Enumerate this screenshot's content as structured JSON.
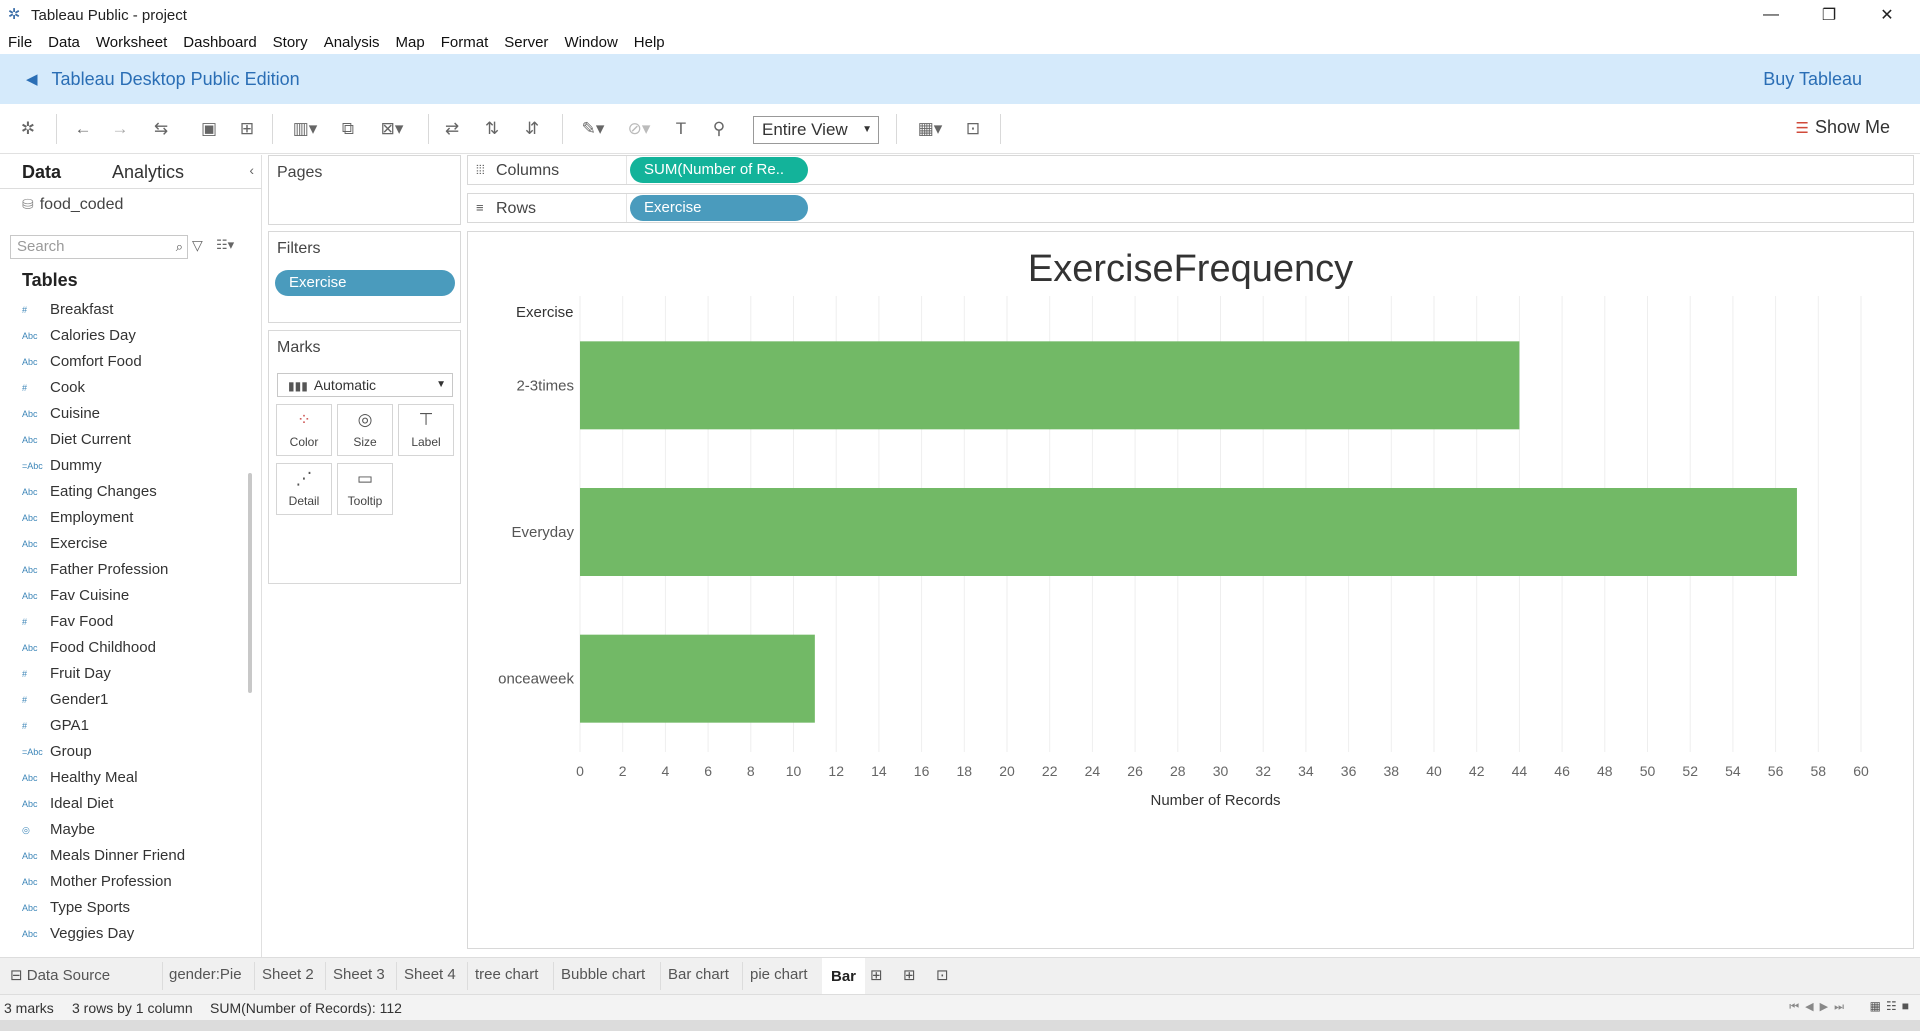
{
  "window": {
    "title": "Tableau Public - project",
    "minimize": "—",
    "restore": "❐",
    "close": "✕"
  },
  "menu": [
    "File",
    "Data",
    "Worksheet",
    "Dashboard",
    "Story",
    "Analysis",
    "Map",
    "Format",
    "Server",
    "Window",
    "Help"
  ],
  "promo": {
    "edition": "Tableau Desktop Public Edition",
    "buy": "Buy Tableau"
  },
  "toolbar": {
    "fit": "Entire View",
    "show_me": "Show Me"
  },
  "left_panel": {
    "tabs": [
      "Data",
      "Analytics"
    ],
    "datasource": "food_coded",
    "search_placeholder": "Search",
    "tables_heading": "Tables",
    "fields": [
      {
        "type": "#",
        "name": "Breakfast"
      },
      {
        "type": "Abc",
        "name": "Calories Day"
      },
      {
        "type": "Abc",
        "name": "Comfort Food"
      },
      {
        "type": "#",
        "name": "Cook"
      },
      {
        "type": "Abc",
        "name": "Cuisine"
      },
      {
        "type": "Abc",
        "name": "Diet Current"
      },
      {
        "type": "=Abc",
        "name": "Dummy"
      },
      {
        "type": "Abc",
        "name": "Eating Changes"
      },
      {
        "type": "Abc",
        "name": "Employment"
      },
      {
        "type": "Abc",
        "name": "Exercise"
      },
      {
        "type": "Abc",
        "name": "Father Profession"
      },
      {
        "type": "Abc",
        "name": "Fav Cuisine"
      },
      {
        "type": "#",
        "name": "Fav Food"
      },
      {
        "type": "Abc",
        "name": "Food Childhood"
      },
      {
        "type": "#",
        "name": "Fruit Day"
      },
      {
        "type": "#",
        "name": "Gender1"
      },
      {
        "type": "#",
        "name": "GPA1"
      },
      {
        "type": "=Abc",
        "name": "Group"
      },
      {
        "type": "Abc",
        "name": "Healthy Meal"
      },
      {
        "type": "Abc",
        "name": "Ideal Diet"
      },
      {
        "type": "◎",
        "name": "Maybe"
      },
      {
        "type": "Abc",
        "name": "Meals Dinner Friend"
      },
      {
        "type": "Abc",
        "name": "Mother Profession"
      },
      {
        "type": "Abc",
        "name": "Type Sports"
      },
      {
        "type": "Abc",
        "name": "Veggies Day"
      }
    ]
  },
  "pages": {
    "title": "Pages"
  },
  "filters": {
    "title": "Filters",
    "pill": "Exercise"
  },
  "marks": {
    "title": "Marks",
    "type": "Automatic",
    "buttons": [
      "Color",
      "Size",
      "Label",
      "Detail",
      "Tooltip"
    ]
  },
  "shelves": {
    "columns_label": "Columns",
    "columns_pill": "SUM(Number of Re..",
    "rows_label": "Rows",
    "rows_pill": "Exercise"
  },
  "chart_data": {
    "type": "bar",
    "orientation": "horizontal",
    "title": "ExerciseFrequency",
    "row_header": "Exercise",
    "categories": [
      "2-3times",
      "Everyday",
      "onceaweek"
    ],
    "values": [
      44,
      57,
      11
    ],
    "xlabel": "Number of Records",
    "xlim": [
      0,
      60
    ],
    "xticks": [
      0,
      2,
      4,
      6,
      8,
      10,
      12,
      14,
      16,
      18,
      20,
      22,
      24,
      26,
      28,
      30,
      32,
      34,
      36,
      38,
      40,
      42,
      44,
      46,
      48,
      50,
      52,
      54,
      56,
      58,
      60
    ],
    "grid": "vertical",
    "bar_color": "#72b966"
  },
  "sheet_tabs": {
    "data_source": "Data Source",
    "sheets": [
      "gender:Pie",
      "Sheet 2",
      "Sheet 3",
      "Sheet 4",
      "tree chart",
      "Bubble chart",
      "Bar chart",
      "pie chart",
      "Bar"
    ],
    "active": "Bar"
  },
  "status": {
    "marks": "3 marks",
    "dims": "3 rows by 1 column",
    "sum": "SUM(Number of Records): 112"
  }
}
